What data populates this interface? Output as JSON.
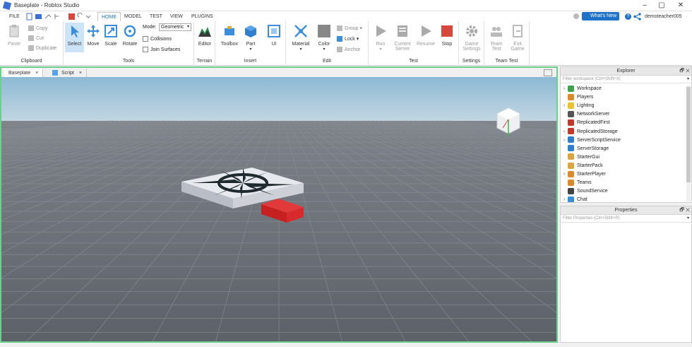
{
  "window": {
    "title": "Baseplate - Roblox Studio",
    "controls": {
      "minimize": "–",
      "maximize": "▢",
      "close": "✕"
    }
  },
  "menu": {
    "file": "FILE",
    "tabs": [
      "HOME",
      "MODEL",
      "TEST",
      "VIEW",
      "PLUGINS"
    ],
    "active_tab": "HOME",
    "whats_new": "What's New",
    "username": "demoteacher005"
  },
  "ribbon": {
    "clipboard": {
      "label": "Clipboard",
      "paste": "Paste",
      "copy": "Copy",
      "cut": "Cut",
      "duplicate": "Duplicate"
    },
    "tools": {
      "label": "Tools",
      "select": "Select",
      "move": "Move",
      "scale": "Scale",
      "rotate": "Rotate",
      "mode_label": "Mode:",
      "mode_value": "Geometric",
      "collisions": "Collisions",
      "join_surfaces": "Join Surfaces"
    },
    "terrain": {
      "label": "Terrain",
      "editor": "Editor"
    },
    "insert": {
      "label": "Insert",
      "toolbox": "Toolbox",
      "part": "Part",
      "ui": "UI"
    },
    "edit": {
      "label": "Edit",
      "material": "Material",
      "color": "Color",
      "group": "Group",
      "lock": "Lock",
      "anchor": "Anchor"
    },
    "test": {
      "label": "Test",
      "run": "Run",
      "current_server_1": "Current",
      "current_server_2": "Server",
      "resume": "Resume",
      "stop": "Stop"
    },
    "settings": {
      "label": "Settings",
      "game_settings_1": "Game",
      "game_settings_2": "Settings"
    },
    "team_test": {
      "label": "Team Test",
      "team_test_1": "Team",
      "team_test_2": "Test",
      "exit_game_1": "Exit",
      "exit_game_2": "Game"
    }
  },
  "doc_tabs": [
    {
      "label": "Baseplate",
      "close": "×"
    },
    {
      "label": "Script",
      "close": "×"
    }
  ],
  "explorer": {
    "title": "Explorer",
    "filter_placeholder": "Filter workspace (Ctrl+Shift+X)",
    "items": [
      {
        "label": "Workspace",
        "expandable": true,
        "color": "#3fa34d"
      },
      {
        "label": "Players",
        "expandable": false,
        "color": "#d98b2b"
      },
      {
        "label": "Lighting",
        "expandable": true,
        "color": "#e8c32e"
      },
      {
        "label": "NetworkServer",
        "expandable": false,
        "color": "#555555"
      },
      {
        "label": "ReplicatedFirst",
        "expandable": false,
        "color": "#c0392b"
      },
      {
        "label": "ReplicatedStorage",
        "expandable": true,
        "color": "#c0392b"
      },
      {
        "label": "ServerScriptService",
        "expandable": true,
        "color": "#2f7fd1"
      },
      {
        "label": "ServerStorage",
        "expandable": false,
        "color": "#2f7fd1"
      },
      {
        "label": "StarterGui",
        "expandable": false,
        "color": "#d9a441"
      },
      {
        "label": "StarterPack",
        "expandable": false,
        "color": "#d9a441"
      },
      {
        "label": "StarterPlayer",
        "expandable": true,
        "color": "#d98b2b"
      },
      {
        "label": "Teams",
        "expandable": false,
        "color": "#d98b2b"
      },
      {
        "label": "SoundService",
        "expandable": false,
        "color": "#444444"
      },
      {
        "label": "Chat",
        "expandable": true,
        "color": "#3a8fd6"
      }
    ]
  },
  "properties": {
    "title": "Properties",
    "filter_placeholder": "Filter Properties (Ctrl+Shift+P)"
  },
  "colors": {
    "accent_green": "#6ccf8e",
    "whats_new_blue": "#1e73c8",
    "stop_red": "#d9463c",
    "sky": "#9fc4dc",
    "baseplate": "#6b6f76",
    "part_red": "#d6282b"
  }
}
